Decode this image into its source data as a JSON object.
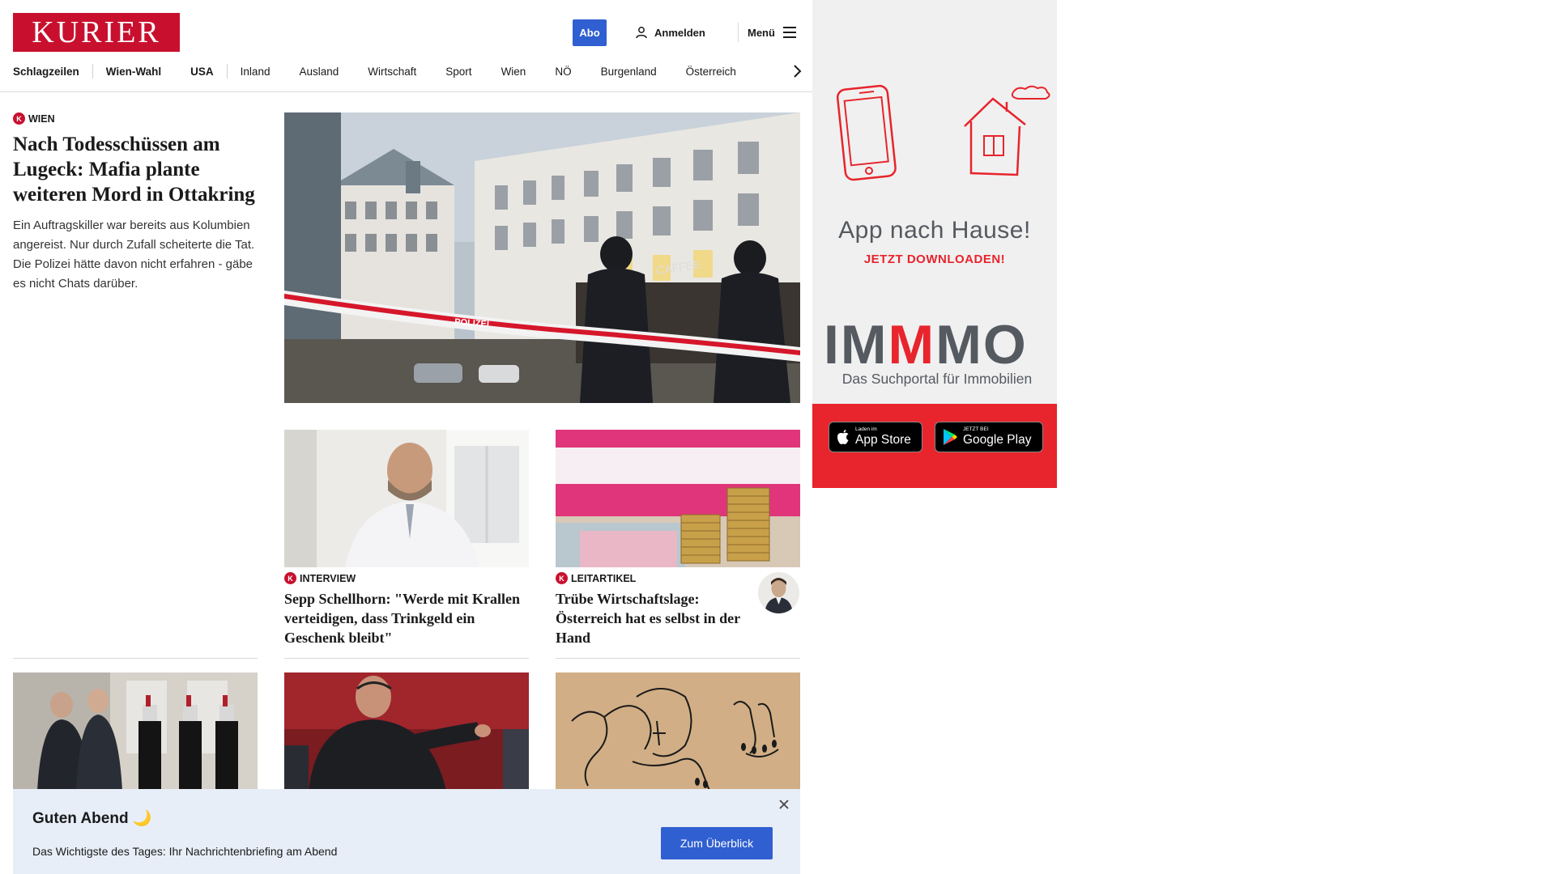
{
  "header": {
    "logo": "KURIER",
    "abo_label": "Abo",
    "login_label": "Anmelden",
    "menu_label": "Menü"
  },
  "nav": {
    "items": [
      "Schlagzeilen",
      "Wien-Wahl",
      "USA",
      "Inland",
      "Ausland",
      "Wirtschaft",
      "Sport",
      "Wien",
      "NÖ",
      "Burgenland",
      "Österreich"
    ]
  },
  "lead": {
    "kicker": "WIEN",
    "headline": "Nach Todesschüssen am Lugeck: Mafia plante weiteren Mord in Ottakring",
    "teaser": "Ein Auftragskiller war bereits aus Kolumbien angereist. Nur durch Zufall scheiterte die Tat. Die Polizei hätte davon nicht erfahren - gäbe es nicht Chats darüber.",
    "image_alt": "Polizisten hinter Absperrband am Lugeck in Wien",
    "tape_text": "POLIZEI",
    "sign_text": "CAFFEE"
  },
  "cards": [
    {
      "kicker": "INTERVIEW",
      "headline": "Sepp Schellhorn: \"Werde mit Krallen verteidigen, dass Trinkgeld ein Geschenk bleibt\""
    },
    {
      "kicker": "LEITARTIKEL",
      "headline": "Trübe Wirtschaftslage: Österreich hat es selbst in der Hand"
    }
  ],
  "badge_letter": "K",
  "briefing": {
    "title": "Guten Abend 🌙",
    "text": "Das Wichtigste des Tages: Ihr Nachrichtenbriefing am Abend",
    "button": "Zum Überblick"
  },
  "ad": {
    "headline": "App nach Hause!",
    "sub": "JETZT DOWNLOADEN!",
    "brand_left": "IM",
    "brand_mid": "M",
    "brand_right": "MO",
    "brand_sub": "Das Suchportal für Immobilien",
    "appstore_small": "Laden im",
    "appstore_big": "App Store",
    "googleplay_small": "JETZT BEI",
    "googleplay_big": "Google Play"
  },
  "colors": {
    "brand_red": "#c8102e",
    "button_blue": "#2f5fd0",
    "ad_red": "#e8242c",
    "briefing_bg": "#e8eef8"
  }
}
